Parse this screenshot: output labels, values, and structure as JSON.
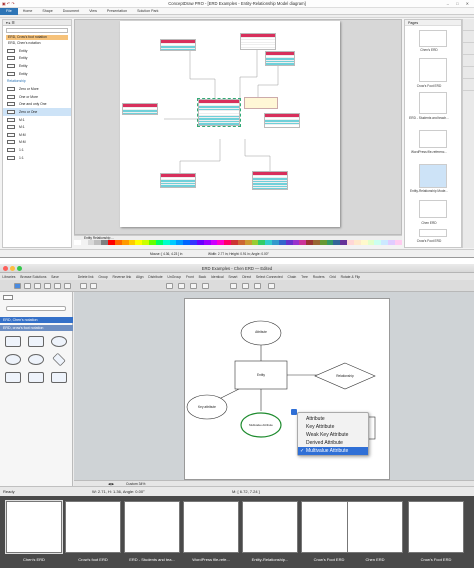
{
  "top_window": {
    "title": "ConceptDraw PRO - [ERD Examples - Entity-Relationship Model diagram]",
    "window_controls": "– □ ✕",
    "menu": [
      "File",
      "Home",
      "Shape",
      "Document",
      "View",
      "Presentation",
      "Solution Park"
    ],
    "library": {
      "tags": [
        "ERD, Crow's foot notation",
        "ERD, Chen's notation"
      ],
      "rows": [
        "Entity",
        "Entity",
        "Entity",
        "Entity"
      ],
      "section": "Relationship",
      "relationship_rows": [
        "Zero or More",
        "One or More",
        "One and only One",
        "Zero or One",
        "M:1",
        "M:1",
        "M:M",
        "M:M",
        "1:1",
        "1:1"
      ]
    },
    "tab_label": "Entity Relationship ...",
    "status_mouse": "Mouse: [ 4.36, 4.23 ] in",
    "status_size": "Width: 2.77 in; Height: 0.91 in; Angle: 0.00°",
    "pages": {
      "header": "Pages",
      "items": [
        "Chen's ERD",
        "Crow's Foot ERD",
        "ERD - Students and teach...",
        "WordPress file-referenc...",
        "Entity-Relationship Mode...",
        "Chen ERD",
        "Crow's Foot ERD"
      ]
    },
    "palette_colors": [
      "#ffffff",
      "#f2f2f2",
      "#d9d9d9",
      "#bfbfbf",
      "#7f7f7f",
      "#ff0000",
      "#ff6600",
      "#ff9900",
      "#ffcc00",
      "#ffff00",
      "#ccff00",
      "#66ff00",
      "#00ff66",
      "#00ffcc",
      "#00ccff",
      "#0099ff",
      "#0066ff",
      "#3333ff",
      "#6600ff",
      "#9900ff",
      "#cc00ff",
      "#ff00cc",
      "#ff0066",
      "#cc3333",
      "#cc6633",
      "#cc9933",
      "#99cc33",
      "#33cc66",
      "#33cccc",
      "#3399cc",
      "#3366cc",
      "#6633cc",
      "#9933cc",
      "#cc3399",
      "#993333",
      "#996633",
      "#669933",
      "#339966",
      "#336699",
      "#663399",
      "#ffd7d7",
      "#ffe9cc",
      "#fff9cc",
      "#e2ffcc",
      "#ccfff0",
      "#cce9ff",
      "#e0ccff",
      "#ffccf0"
    ]
  },
  "bottom_window": {
    "title": "ERD Examples - Chen ERD — Edited",
    "menu": [
      "Libraries",
      "Browse Solutions",
      "Save",
      "Delete link",
      "Group",
      "Reverse link",
      "Align",
      "Distribute",
      "UnGroup",
      "Front",
      "Back",
      "Identical",
      "Smart",
      "Direct",
      "Select Connected",
      "Chain",
      "Tree",
      "Routers",
      "Grid",
      "Rotate & Flip"
    ],
    "library_categories": [
      "ERD, Chen's notation",
      "ERD, crow's foot notation"
    ],
    "zoom": "Custom 34%",
    "status_ready": "Ready",
    "status_dims": "W: 2.71,  H: 1.36,  Angle: 0.00°",
    "status_mouse": "M: [ 6.72, 7.24 ]",
    "canvas_labels": {
      "attribute_top": "Attribute",
      "entity": "Entity",
      "relationship": "Relationship",
      "key_attribute": "Key attribute",
      "selected_shape": "Multivalue Attribute"
    },
    "context_menu": {
      "items": [
        "Attribute",
        "Key Attribute",
        "Weak Key Attribute",
        "Derived Attribute",
        "Multivalue Attribute"
      ],
      "checked_index": 4,
      "check_mark": "✓"
    },
    "thumbnails": [
      "Chen's ERD",
      "Crow's foot ERD",
      "ERD - Students and tea...",
      "WordPress file-refe...",
      "Entity-Relationship...",
      "Crow's Foot ERD",
      "Chen ERD",
      "Crow's Foot ERD"
    ]
  },
  "colors": {
    "entity_header": "#d7305c",
    "entity_key": "#6fd0d9",
    "selection_green": "#1e8b2e",
    "menu_highlight": "#2f6fd6",
    "library_tag": "#f6c27a"
  }
}
